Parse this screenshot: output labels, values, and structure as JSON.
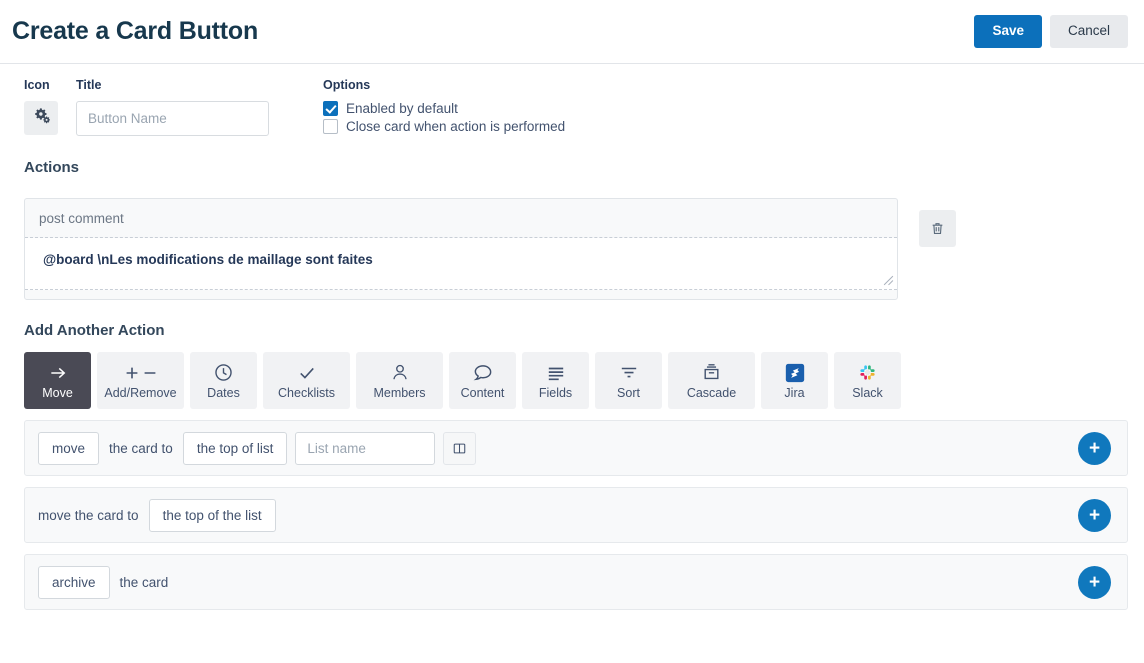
{
  "header": {
    "title": "Create a Card Button",
    "save_label": "Save",
    "cancel_label": "Cancel",
    "save_color": "#0c70bb",
    "cancel_color": "#e8eaed"
  },
  "form": {
    "icon_label": "Icon",
    "icon_glyph": "cogs-icon",
    "title_label": "Title",
    "title_value": "",
    "title_placeholder": "Button Name",
    "options_label": "Options",
    "options": [
      {
        "label": "Enabled by default",
        "checked": true
      },
      {
        "label": "Close card when action is performed",
        "checked": false
      }
    ]
  },
  "actions_section": {
    "title": "Actions",
    "action": {
      "type_label": "post comment",
      "comment_text": "@board \\nLes modifications de maillage sont faites",
      "delete_icon": "trash-icon"
    }
  },
  "add_action_section": {
    "title": "Add Another Action",
    "tabs": [
      {
        "label": "Move",
        "icon": "arrow-right-icon",
        "active": true,
        "wide": false
      },
      {
        "label": "Add/Remove",
        "icon": "plus-minus-icon",
        "active": false,
        "wide": true
      },
      {
        "label": "Dates",
        "icon": "clock-icon",
        "active": false,
        "wide": false
      },
      {
        "label": "Checklists",
        "icon": "check-icon",
        "active": false,
        "wide": true
      },
      {
        "label": "Members",
        "icon": "person-icon",
        "active": false,
        "wide": true
      },
      {
        "label": "Content",
        "icon": "speech-bubble-icon",
        "active": false,
        "wide": false
      },
      {
        "label": "Fields",
        "icon": "lines-icon",
        "active": false,
        "wide": false
      },
      {
        "label": "Sort",
        "icon": "funnel-icon",
        "active": false,
        "wide": false
      },
      {
        "label": "Cascade",
        "icon": "archive-box-icon",
        "active": false,
        "wide": true
      },
      {
        "label": "Jira",
        "icon": "jira-icon",
        "active": false,
        "wide": false
      },
      {
        "label": "Slack",
        "icon": "slack-icon",
        "active": false,
        "wide": false
      }
    ],
    "rows": [
      {
        "verb": "move",
        "text1": "the card to",
        "position": "the top of list",
        "list_value": "",
        "list_placeholder": "List name",
        "board_icon": "board-columns-icon",
        "add_label": "+"
      },
      {
        "text1": "move the card to",
        "position": "the top of the list",
        "add_label": "+"
      },
      {
        "verb": "archive",
        "text1": "the card",
        "add_label": "+"
      }
    ]
  }
}
